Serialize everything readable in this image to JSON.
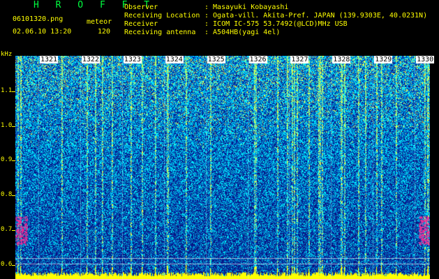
{
  "header": {
    "app_title": "H R O F F T",
    "file_name": "06101320.png",
    "datetime": "02.06.10 13:20",
    "meteor_label": "meteor",
    "meteor_count": "120",
    "fields": [
      {
        "label": "Observer",
        "value": ": Masayuki Kobayashi"
      },
      {
        "label": "Receiving Location",
        "value": ": Ogata-vill. Akita-Pref. JAPAN (139.9303E, 40.0231N)"
      },
      {
        "label": "Receiver",
        "value": ": ICOM IC-575 53.7492(@LCD)MHz USB"
      },
      {
        "label": "Receiving antenna",
        "value": ": A504HB(yagi 4el)"
      }
    ]
  },
  "spectrogram": {
    "y_unit": "kHz",
    "y_ticks": [
      "1.1",
      "1.0",
      "0.9",
      "0.8",
      "0.7",
      "0.6"
    ],
    "y_values": [
      1.1,
      1.0,
      0.9,
      0.8,
      0.7,
      0.6
    ],
    "x_ticks": [
      "1321",
      "1322",
      "1323",
      "1324",
      "1325",
      "1326",
      "1327",
      "1328",
      "1329",
      "1330"
    ],
    "x_minutes": [
      1321,
      1322,
      1323,
      1324,
      1325,
      1326,
      1327,
      1328,
      1329,
      1330
    ],
    "colors": {
      "bg": "#000000",
      "axis": "#ffff00",
      "deep": "#0a1a8c",
      "noise": "#00c8ff",
      "hot": "#ff2090",
      "bar": "#ffff00"
    }
  }
}
